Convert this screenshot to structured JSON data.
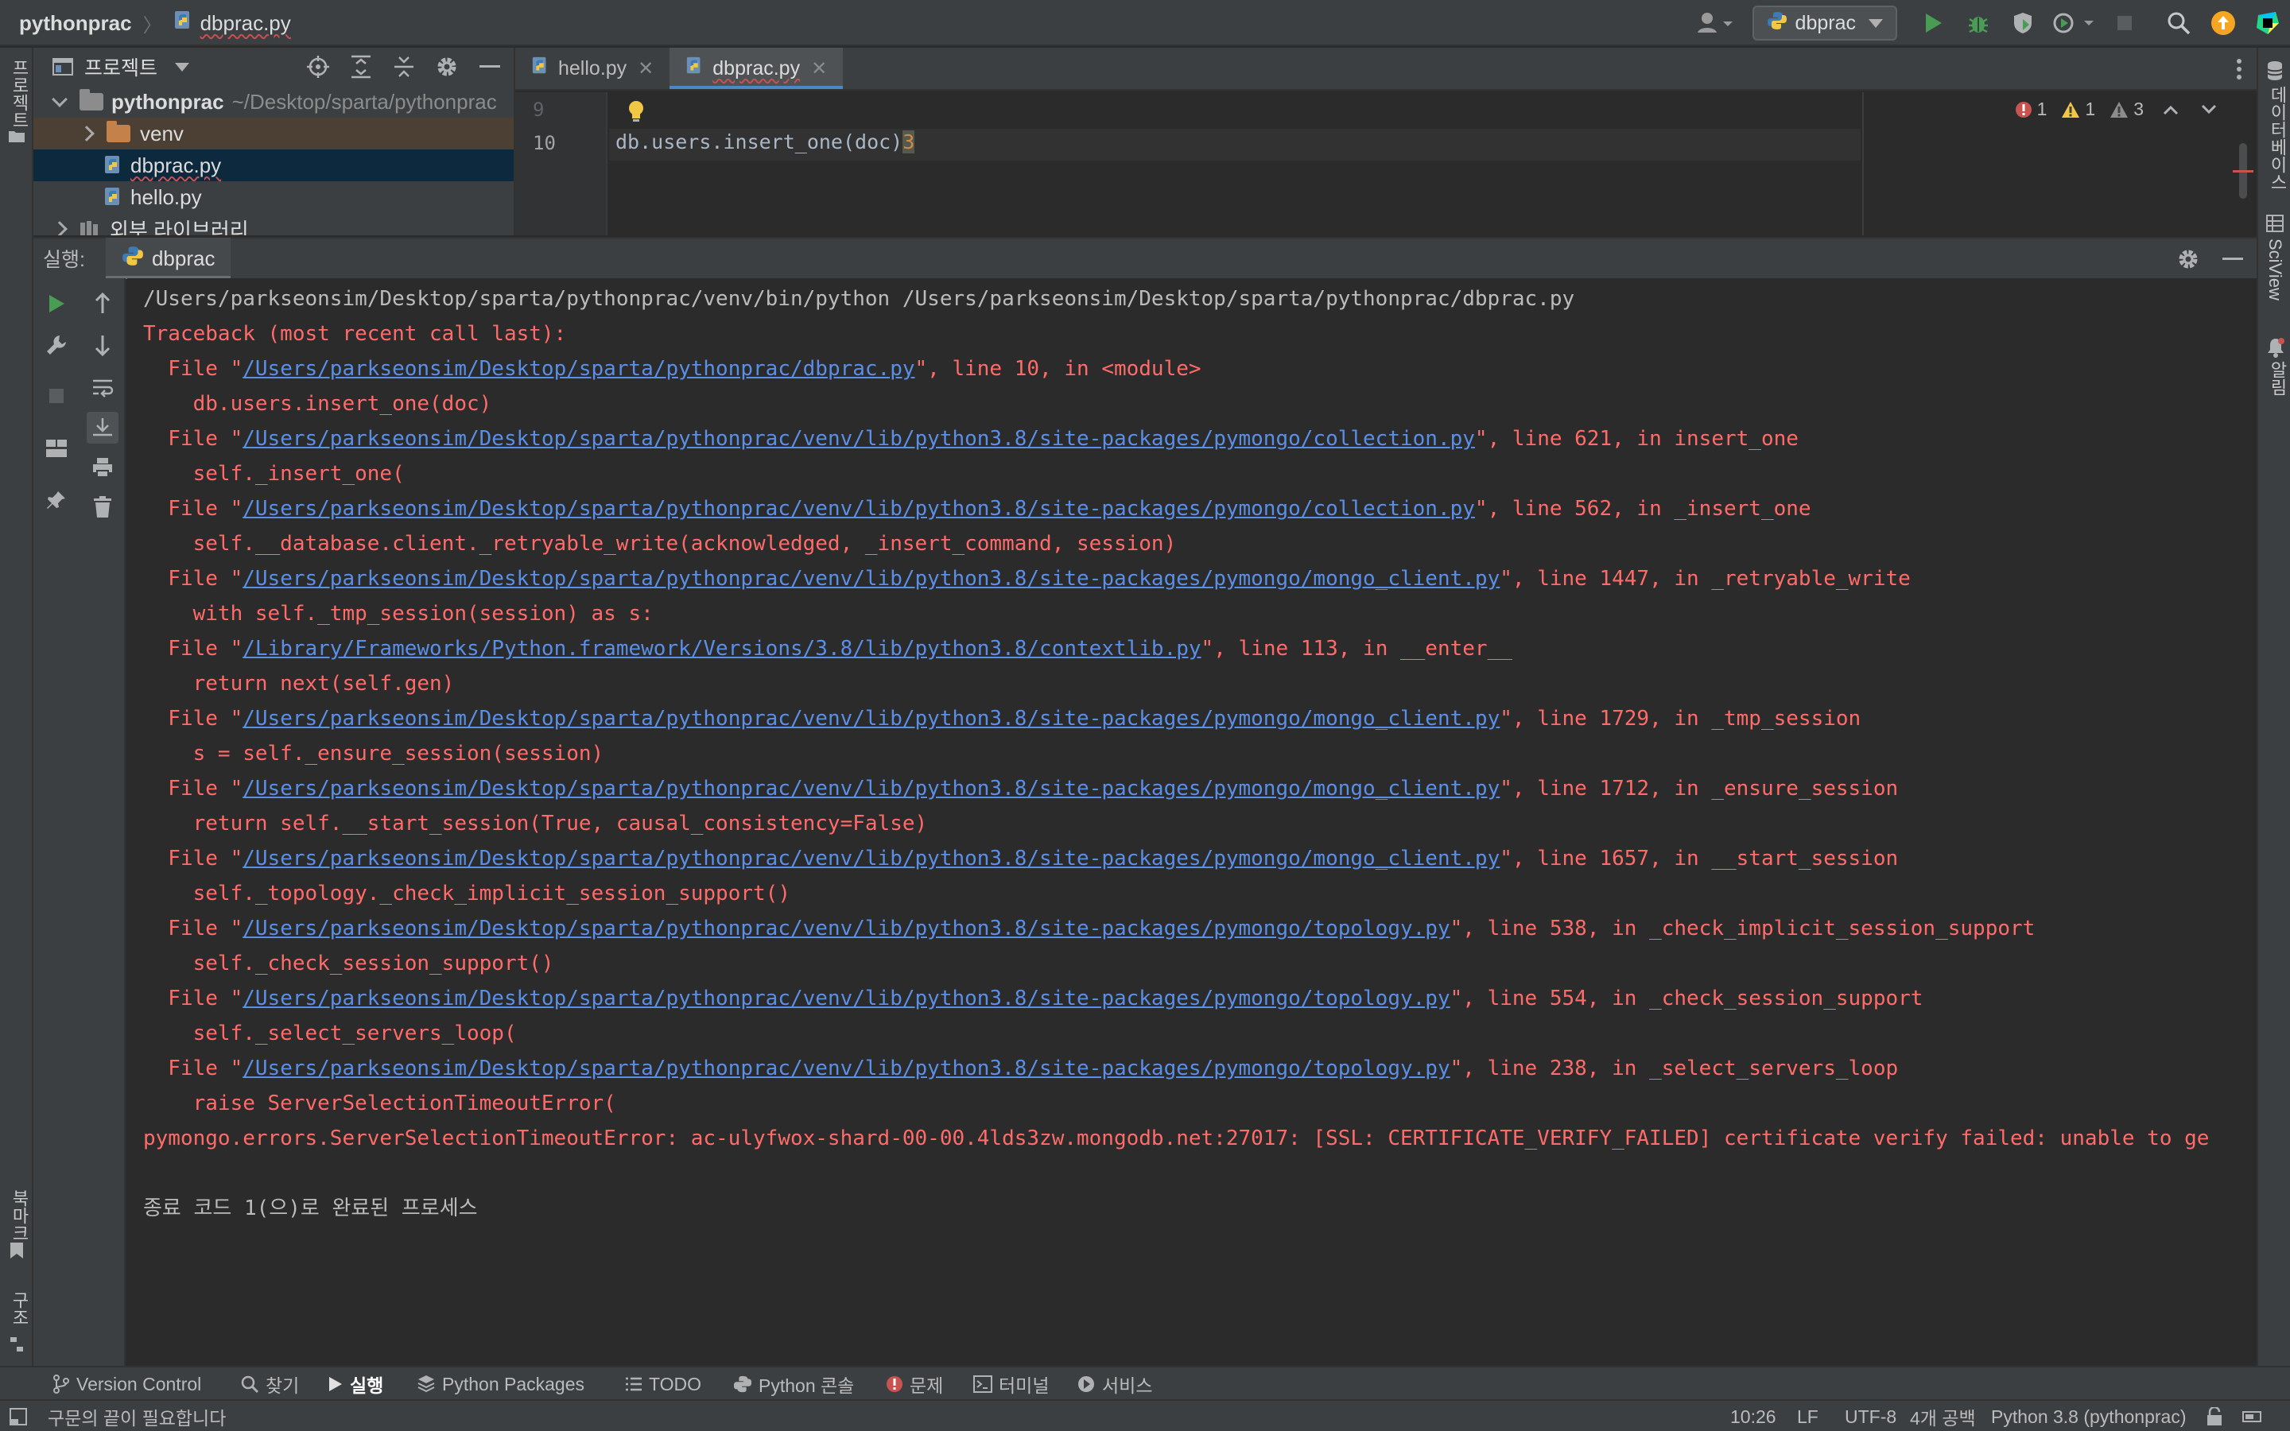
{
  "titlebar": {
    "project": "pythonprac",
    "file": "dbprac.py",
    "run_config": "dbprac"
  },
  "left_strip": {
    "project_label": "프로젝트",
    "bookmarks_label": "북마크",
    "structure_label": "구조"
  },
  "right_strip": {
    "database_label": "데이터베이스",
    "sciview_label": "SciView",
    "notifications_label": "알림"
  },
  "project_panel": {
    "title": "프로젝트",
    "tree": [
      {
        "label": "pythonprac",
        "path": "~/Desktop/sparta/pythonprac"
      },
      {
        "label": "venv"
      },
      {
        "label": "dbprac.py"
      },
      {
        "label": "hello.py"
      },
      {
        "label": "외부 라이브러리"
      }
    ]
  },
  "editor": {
    "tabs": [
      {
        "label": "hello.py"
      },
      {
        "label": "dbprac.py"
      }
    ],
    "lines": [
      {
        "number": "9",
        "text": ""
      },
      {
        "number": "10",
        "text": "db.users.insert_one(doc)",
        "cursor_char": "3"
      }
    ],
    "inspections": {
      "errors": "1",
      "warnings": "1",
      "weak_warnings": "3"
    }
  },
  "run_panel": {
    "label": "실행:",
    "tab": "dbprac",
    "console": [
      {
        "type": "cmd",
        "text": "/Users/parkseonsim/Desktop/sparta/pythonprac/venv/bin/python /Users/parkseonsim/Desktop/sparta/pythonprac/dbprac.py"
      },
      {
        "type": "err",
        "text": "Traceback (most recent call last):"
      },
      {
        "type": "file",
        "pre": "  File \"",
        "link": "/Users/parkseonsim/Desktop/sparta/pythonprac/dbprac.py",
        "post": "\", line 10, in <module>"
      },
      {
        "type": "err",
        "text": "    db.users.insert_one(doc)"
      },
      {
        "type": "file",
        "pre": "  File \"",
        "link": "/Users/parkseonsim/Desktop/sparta/pythonprac/venv/lib/python3.8/site-packages/pymongo/collection.py",
        "post": "\", line 621, in insert_one"
      },
      {
        "type": "err",
        "text": "    self._insert_one("
      },
      {
        "type": "file",
        "pre": "  File \"",
        "link": "/Users/parkseonsim/Desktop/sparta/pythonprac/venv/lib/python3.8/site-packages/pymongo/collection.py",
        "post": "\", line 562, in _insert_one"
      },
      {
        "type": "err",
        "text": "    self.__database.client._retryable_write(acknowledged, _insert_command, session)"
      },
      {
        "type": "file",
        "pre": "  File \"",
        "link": "/Users/parkseonsim/Desktop/sparta/pythonprac/venv/lib/python3.8/site-packages/pymongo/mongo_client.py",
        "post": "\", line 1447, in _retryable_write"
      },
      {
        "type": "err",
        "text": "    with self._tmp_session(session) as s:"
      },
      {
        "type": "file",
        "pre": "  File \"",
        "link": "/Library/Frameworks/Python.framework/Versions/3.8/lib/python3.8/contextlib.py",
        "post": "\", line 113, in __enter__"
      },
      {
        "type": "err",
        "text": "    return next(self.gen)"
      },
      {
        "type": "file",
        "pre": "  File \"",
        "link": "/Users/parkseonsim/Desktop/sparta/pythonprac/venv/lib/python3.8/site-packages/pymongo/mongo_client.py",
        "post": "\", line 1729, in _tmp_session"
      },
      {
        "type": "err",
        "text": "    s = self._ensure_session(session)"
      },
      {
        "type": "file",
        "pre": "  File \"",
        "link": "/Users/parkseonsim/Desktop/sparta/pythonprac/venv/lib/python3.8/site-packages/pymongo/mongo_client.py",
        "post": "\", line 1712, in _ensure_session"
      },
      {
        "type": "err",
        "text": "    return self.__start_session(True, causal_consistency=False)"
      },
      {
        "type": "file",
        "pre": "  File \"",
        "link": "/Users/parkseonsim/Desktop/sparta/pythonprac/venv/lib/python3.8/site-packages/pymongo/mongo_client.py",
        "post": "\", line 1657, in __start_session"
      },
      {
        "type": "err",
        "text": "    self._topology._check_implicit_session_support()"
      },
      {
        "type": "file",
        "pre": "  File \"",
        "link": "/Users/parkseonsim/Desktop/sparta/pythonprac/venv/lib/python3.8/site-packages/pymongo/topology.py",
        "post": "\", line 538, in _check_implicit_session_support"
      },
      {
        "type": "err",
        "text": "    self._check_session_support()"
      },
      {
        "type": "file",
        "pre": "  File \"",
        "link": "/Users/parkseonsim/Desktop/sparta/pythonprac/venv/lib/python3.8/site-packages/pymongo/topology.py",
        "post": "\", line 554, in _check_session_support"
      },
      {
        "type": "err",
        "text": "    self._select_servers_loop("
      },
      {
        "type": "file",
        "pre": "  File \"",
        "link": "/Users/parkseonsim/Desktop/sparta/pythonprac/venv/lib/python3.8/site-packages/pymongo/topology.py",
        "post": "\", line 238, in _select_servers_loop"
      },
      {
        "type": "err",
        "text": "    raise ServerSelectionTimeoutError("
      },
      {
        "type": "err",
        "text": "pymongo.errors.ServerSelectionTimeoutError: ac-ulyfwox-shard-00-00.4lds3zw.mongodb.net:27017: [SSL: CERTIFICATE_VERIFY_FAILED] certificate verify failed: unable to ge"
      },
      {
        "type": "blank",
        "text": ""
      },
      {
        "type": "cmd",
        "text": "종료 코드 1(으)로 완료된 프로세스"
      }
    ]
  },
  "bottom_tools": [
    {
      "label": "Version Control",
      "icon": "branch-icon"
    },
    {
      "label": "찾기",
      "icon": "search-icon"
    },
    {
      "label": "실행",
      "icon": "run-icon",
      "active": true
    },
    {
      "label": "Python Packages",
      "icon": "packages-icon"
    },
    {
      "label": "TODO",
      "icon": "list-icon"
    },
    {
      "label": "Python 콘솔",
      "icon": "python-icon"
    },
    {
      "label": "문제",
      "icon": "problems-icon"
    },
    {
      "label": "터미널",
      "icon": "terminal-icon"
    },
    {
      "label": "서비스",
      "icon": "services-icon"
    }
  ],
  "status_bar": {
    "message": "구문의 끝이 필요합니다",
    "position": "10:26",
    "line_sep": "LF",
    "encoding": "UTF-8",
    "indent": "4개 공백",
    "interpreter": "Python 3.8 (pythonprac)"
  },
  "colors": {
    "accent": "#4a88c7",
    "error": "#ff6b68",
    "link": "#5a8fe8",
    "run_green": "#499c54"
  }
}
